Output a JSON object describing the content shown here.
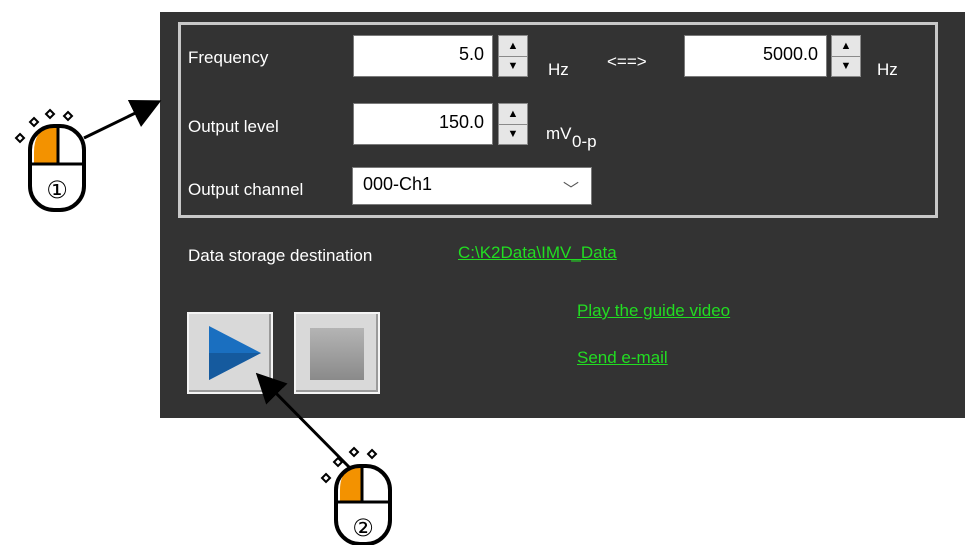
{
  "frequency": {
    "label": "Frequency",
    "start_value": "5.0",
    "start_unit": "Hz",
    "range_sep": "<==>",
    "end_value": "5000.0",
    "end_unit": "Hz"
  },
  "output_level": {
    "label": "Output level",
    "value": "150.0",
    "unit": "mV",
    "unit_suffix": "0-p"
  },
  "output_channel": {
    "label": "Output channel",
    "selected": "000-Ch1"
  },
  "storage": {
    "label": "Data storage destination",
    "path": "C:\\K2Data\\IMV_Data"
  },
  "links": {
    "guide_video": "Play the guide video",
    "email": "Send e-mail"
  },
  "annotations": {
    "marker_1": "①",
    "marker_2": "②",
    "mouse_highlight_color": "#f39200"
  },
  "colors": {
    "panel_bg": "#333333",
    "link": "#22dd22",
    "play": "#1a6fc0"
  }
}
